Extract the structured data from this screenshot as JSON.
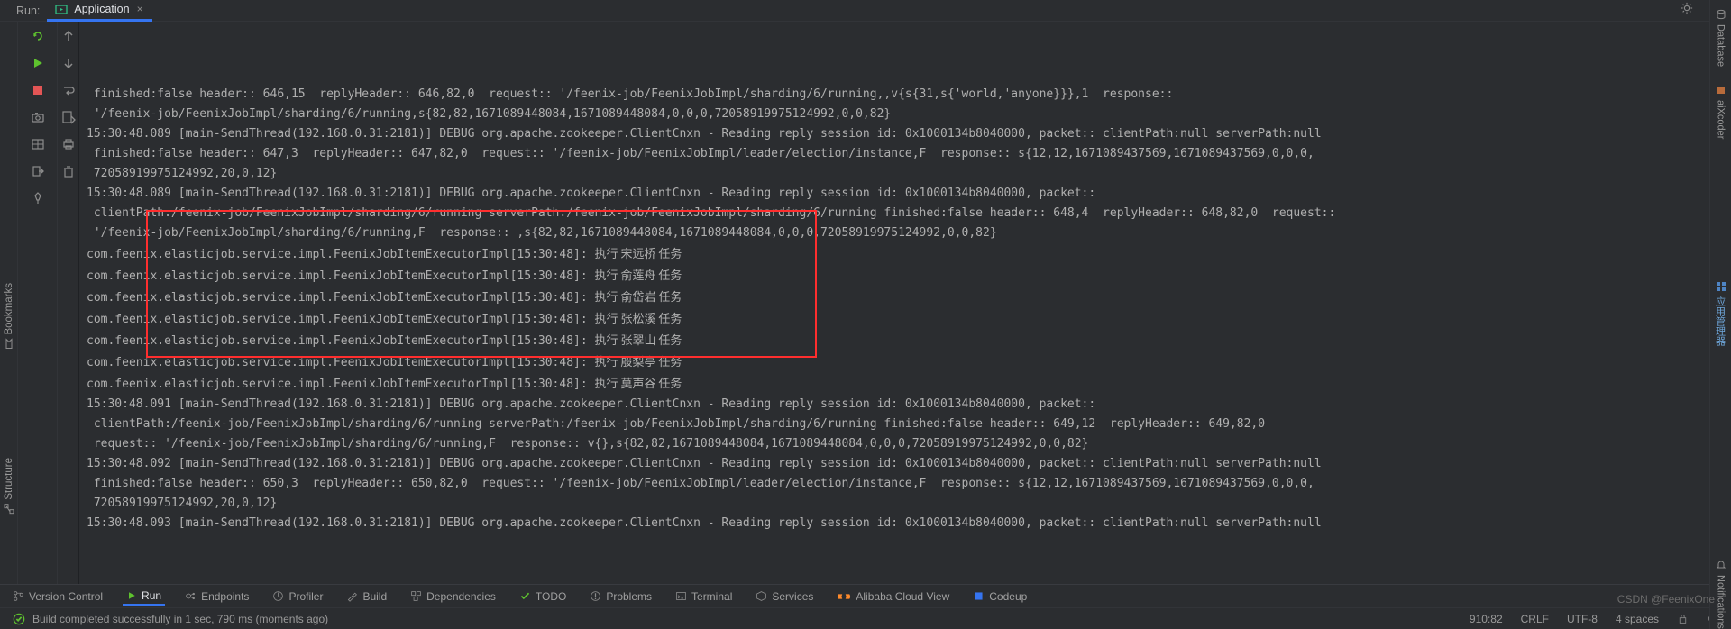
{
  "topbar": {
    "run_label": "Run:",
    "tab_label": "Application"
  },
  "right_rail": {
    "database": "Database",
    "aix": "aiXcoder",
    "notif": "Notifications"
  },
  "left_rail": {
    "bookmarks": "Bookmarks",
    "structure": "Structure"
  },
  "console_lines": [
    " finished:false header:: 646,15  replyHeader:: 646,82,0  request:: '/feenix-job/FeenixJobImpl/sharding/6/running,,v{s{31,s{'world,'anyone}}},1  response:: ",
    " '/feenix-job/FeenixJobImpl/sharding/6/running,s{82,82,1671089448084,1671089448084,0,0,0,72058919975124992,0,0,82} ",
    "15:30:48.089 [main-SendThread(192.168.0.31:2181)] DEBUG org.apache.zookeeper.ClientCnxn - Reading reply session id: 0x1000134b8040000, packet:: clientPath:null serverPath:null",
    " finished:false header:: 647,3  replyHeader:: 647,82,0  request:: '/feenix-job/FeenixJobImpl/leader/election/instance,F  response:: s{12,12,1671089437569,1671089437569,0,0,0,",
    " 72058919975124992,20,0,12} ",
    "15:30:48.089 [main-SendThread(192.168.0.31:2181)] DEBUG org.apache.zookeeper.ClientCnxn - Reading reply session id: 0x1000134b8040000, packet:: ",
    " clientPath:/feenix-job/FeenixJobImpl/sharding/6/running serverPath:/feenix-job/FeenixJobImpl/sharding/6/running finished:false header:: 648,4  replyHeader:: 648,82,0  request:: ",
    " '/feenix-job/FeenixJobImpl/sharding/6/running,F  response:: ,s{82,82,1671089448084,1671089448084,0,0,0,72058919975124992,0,0,82} "
  ],
  "exec_lines": [
    {
      "prefix": "com.feenix.elasticjob.service.impl.FeenixJobItemExecutorImpl[15:30:48]: ",
      "cn": "执行 宋远桥 任务"
    },
    {
      "prefix": "com.feenix.elasticjob.service.impl.FeenixJobItemExecutorImpl[15:30:48]: ",
      "cn": "执行 俞莲舟 任务"
    },
    {
      "prefix": "com.feenix.elasticjob.service.impl.FeenixJobItemExecutorImpl[15:30:48]: ",
      "cn": "执行 俞岱岩 任务"
    },
    {
      "prefix": "com.feenix.elasticjob.service.impl.FeenixJobItemExecutorImpl[15:30:48]: ",
      "cn": "执行 张松溪 任务"
    },
    {
      "prefix": "com.feenix.elasticjob.service.impl.FeenixJobItemExecutorImpl[15:30:48]: ",
      "cn": "执行 张翠山 任务"
    },
    {
      "prefix": "com.feenix.elasticjob.service.impl.FeenixJobItemExecutorImpl[15:30:48]: ",
      "cn": "执行 殷梨亭 任务"
    },
    {
      "prefix": "com.feenix.elasticjob.service.impl.FeenixJobItemExecutorImpl[15:30:48]: ",
      "cn": "执行 莫声谷 任务"
    }
  ],
  "console_lines2": [
    "15:30:48.091 [main-SendThread(192.168.0.31:2181)] DEBUG org.apache.zookeeper.ClientCnxn - Reading reply session id: 0x1000134b8040000, packet:: ",
    " clientPath:/feenix-job/FeenixJobImpl/sharding/6/running serverPath:/feenix-job/FeenixJobImpl/sharding/6/running finished:false header:: 649,12  replyHeader:: 649,82,0 ",
    " request:: '/feenix-job/FeenixJobImpl/sharding/6/running,F  response:: v{},s{82,82,1671089448084,1671089448084,0,0,0,72058919975124992,0,0,82} ",
    "15:30:48.092 [main-SendThread(192.168.0.31:2181)] DEBUG org.apache.zookeeper.ClientCnxn - Reading reply session id: 0x1000134b8040000, packet:: clientPath:null serverPath:null",
    " finished:false header:: 650,3  replyHeader:: 650,82,0  request:: '/feenix-job/FeenixJobImpl/leader/election/instance,F  response:: s{12,12,1671089437569,1671089437569,0,0,0,",
    " 72058919975124992,20,0,12} ",
    "15:30:48.093 [main-SendThread(192.168.0.31:2181)] DEBUG org.apache.zookeeper.ClientCnxn - Reading reply session id: 0x1000134b8040000, packet:: clientPath:null serverPath:null"
  ],
  "bottom": {
    "version_control": "Version Control",
    "run": "Run",
    "endpoints": "Endpoints",
    "profiler": "Profiler",
    "build": "Build",
    "dependencies": "Dependencies",
    "todo": "TODO",
    "problems": "Problems",
    "terminal": "Terminal",
    "services": "Services",
    "aliyun": "Alibaba Cloud View",
    "codeup": "Codeup"
  },
  "status": {
    "message": "Build completed successfully in 1 sec, 790 ms (moments ago)",
    "pos": "910:82",
    "crlf": "CRLF",
    "enc": "UTF-8",
    "indent": "4 spaces"
  },
  "watermark": "CSDN @FeenixOne"
}
